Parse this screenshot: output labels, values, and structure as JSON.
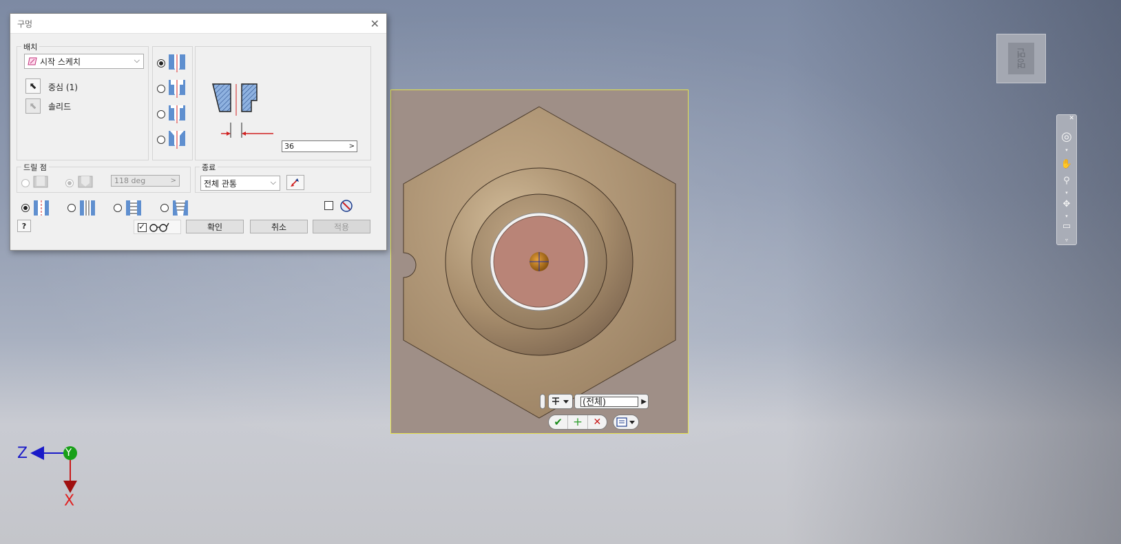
{
  "dialog": {
    "title": "구멍",
    "close_glyph": "✕",
    "placement": {
      "group_label": "배치",
      "type_value": "시작 스케치",
      "center_label": "중심 (1)",
      "solid_label": "솔리드"
    },
    "dimension_value": "36",
    "drill_point": {
      "group_label": "드릴 점",
      "angle_value": "118 deg"
    },
    "termination": {
      "group_label": "종료",
      "value": "전체 관통"
    },
    "buttons": {
      "ok": "확인",
      "cancel": "취소",
      "apply": "적용",
      "help": "?"
    }
  },
  "viewcube": {
    "face_label": "명면"
  },
  "mini_toolbar": {
    "field_value": "(전체)"
  },
  "axes": {
    "z": "Z",
    "y": "Y",
    "x": "X"
  },
  "colors": {
    "part_body": "#a8916f",
    "hole_face": "#b98477",
    "highlight_frame": "#e6e24a",
    "accent_red": "#d01f1f",
    "axis_z": "#1a1ac8",
    "axis_y": "#18a018",
    "axis_x": "#c81a1a"
  }
}
